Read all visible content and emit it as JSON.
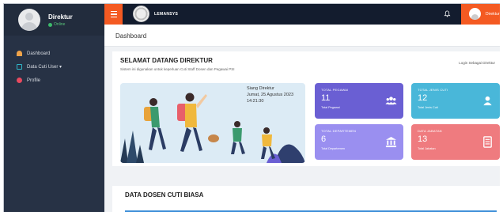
{
  "sidebar": {
    "user": {
      "name": "Direktur",
      "status": "Online"
    },
    "items": [
      {
        "label": "Dashboard",
        "icon": "dashboard-icon"
      },
      {
        "label": "Data Cuti User ▾",
        "icon": "data-icon"
      },
      {
        "label": "Profile",
        "icon": "profile-icon"
      }
    ]
  },
  "topbar": {
    "app_name": "LEMANSYS",
    "user_name": "Direktur",
    "accent": "#f45a22"
  },
  "page": {
    "title": "Dashboard"
  },
  "welcome": {
    "title": "SELAMAT DATANG DIREKTUR",
    "subtitle": "Sistem ini digunakan untuk keperluan Cuti Staff Dosen dan Pegawai PSI",
    "change_link": "Login Sebagai Direktur",
    "greeting": "Siang Direktur",
    "date": "Jumat, 25 Agustus 2023",
    "time": "14:21:30"
  },
  "stats": [
    {
      "label": "TOTAL PEGAWAI",
      "value": "11",
      "sub": "Total Pegawai",
      "icon": "users-icon",
      "color": "#6a5fd3"
    },
    {
      "label": "TOTAL JENIS CUTI",
      "value": "12",
      "sub": "Total Jenis Cuti",
      "icon": "user-icon",
      "color": "#49b7d9"
    },
    {
      "label": "TOTAL DEPARTEMEN",
      "value": "6",
      "sub": "Total Departemen",
      "icon": "building-icon",
      "color": "#9a8ff0"
    },
    {
      "label": "DATA JABATAN",
      "value": "13",
      "sub": "Total Jabatan",
      "icon": "document-icon",
      "color": "#ef7b7f"
    }
  ],
  "table": {
    "title": "DATA DOSEN CUTI BIASA"
  }
}
